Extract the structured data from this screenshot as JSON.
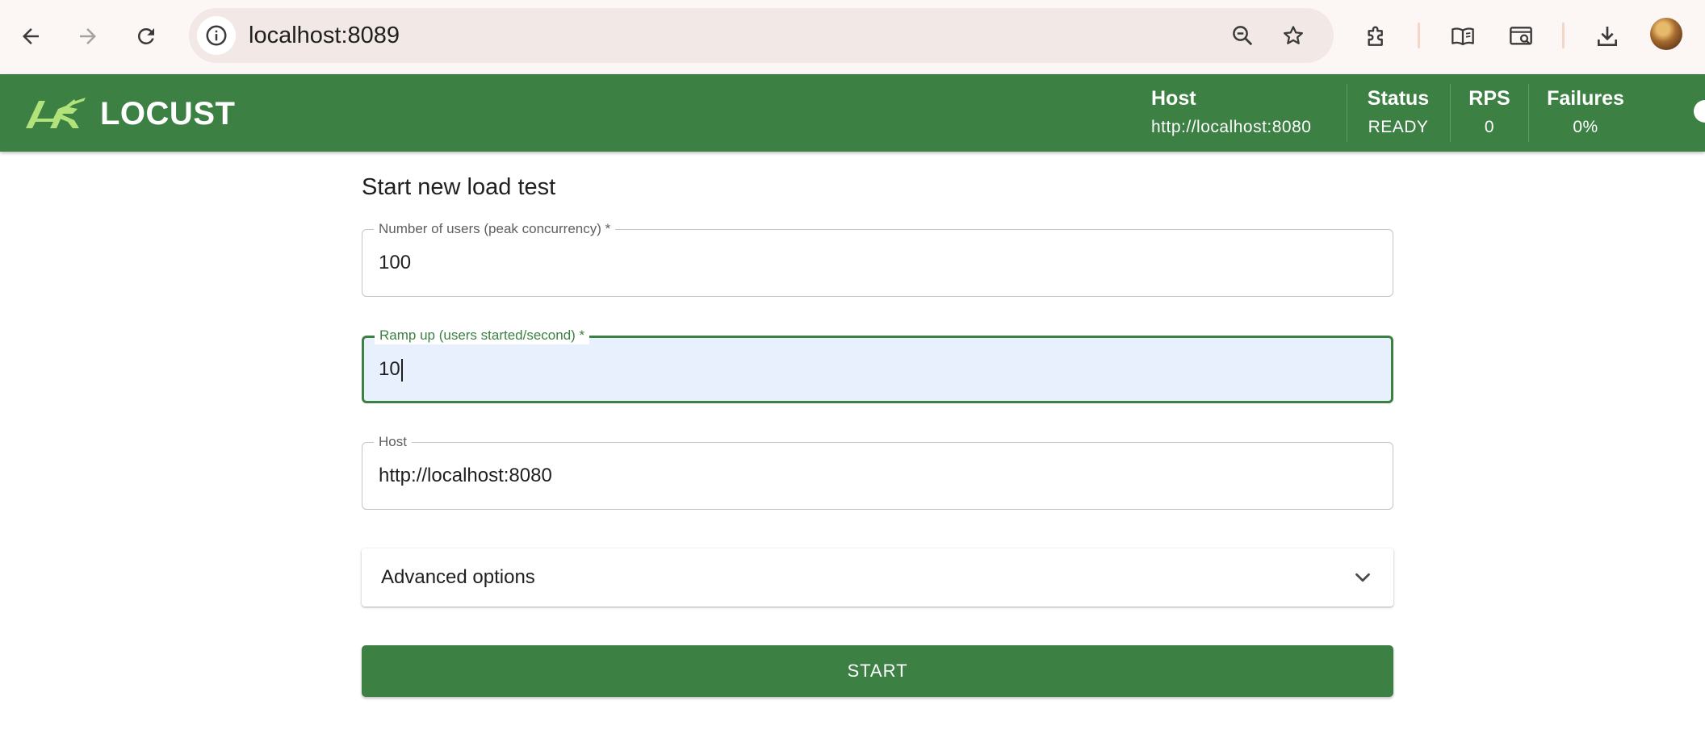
{
  "browser": {
    "url": "localhost:8089",
    "icons": {
      "back": "arrow-left-icon",
      "forward": "arrow-right-icon",
      "reload": "reload-icon",
      "site_info": "info-icon",
      "zoom": "zoom-out-icon",
      "bookmark": "star-icon",
      "extensions": "puzzle-icon",
      "reading_mode": "book-icon",
      "search_page": "search-tab-icon",
      "downloads": "download-icon",
      "profile": "avatar"
    }
  },
  "header": {
    "logo_text": "LOCUST",
    "stats": [
      {
        "label": "Host",
        "value": "http://localhost:8080"
      },
      {
        "label": "Status",
        "value": "READY"
      },
      {
        "label": "RPS",
        "value": "0"
      },
      {
        "label": "Failures",
        "value": "0%"
      }
    ],
    "colors": {
      "background": "#3c8044",
      "logo_accent": "#b2e37a"
    }
  },
  "form": {
    "title": "Start new load test",
    "users": {
      "label": "Number of users (peak concurrency) *",
      "value": "100"
    },
    "ramp_up": {
      "label": "Ramp up (users started/second) *",
      "value": "10"
    },
    "host": {
      "label": "Host",
      "value": "http://localhost:8080"
    },
    "advanced_label": "Advanced options",
    "start_label": "START"
  }
}
